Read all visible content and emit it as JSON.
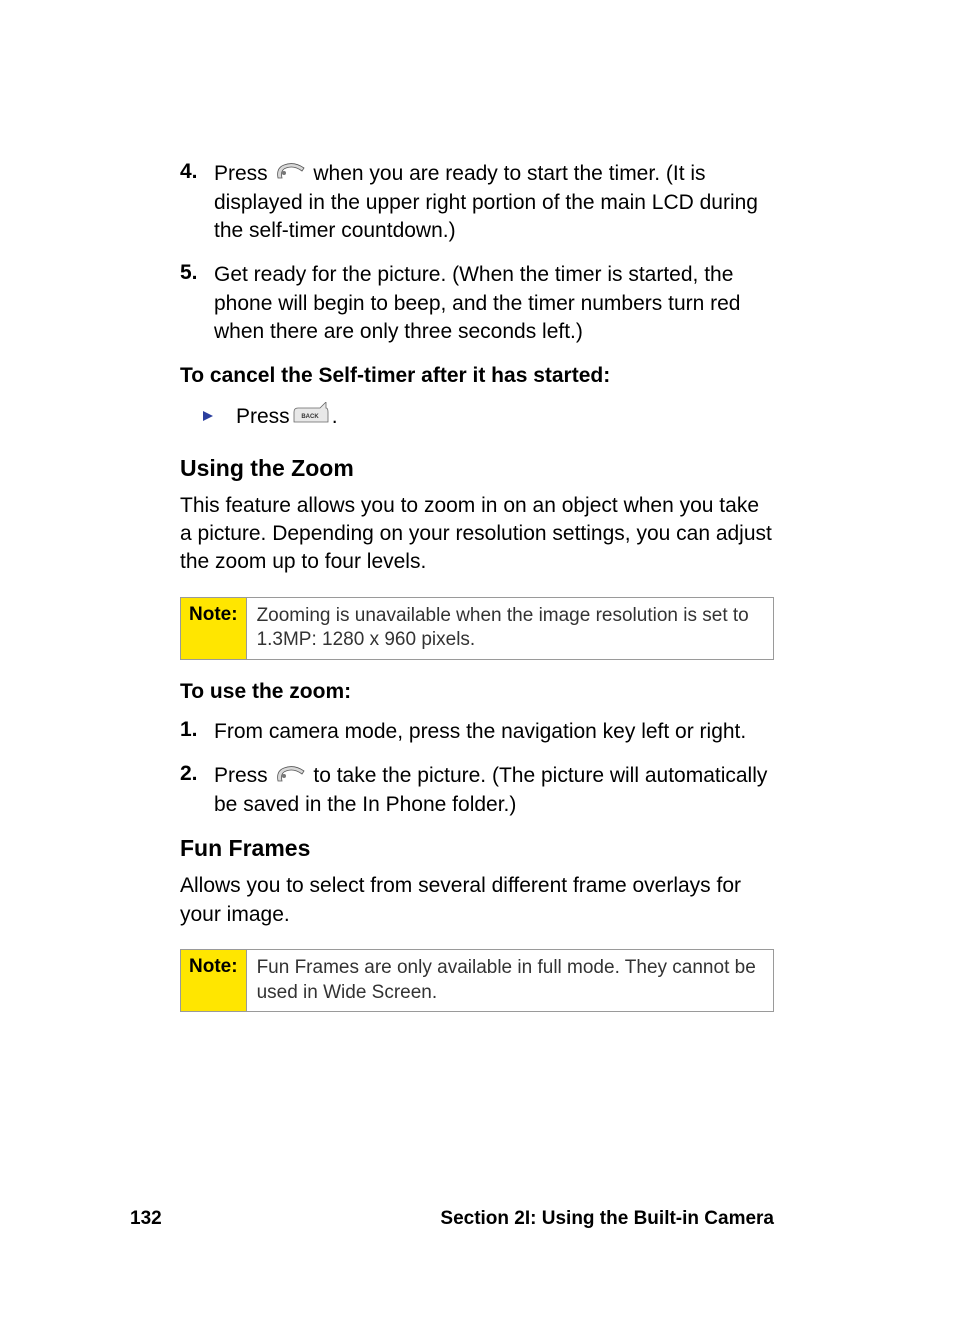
{
  "steps_top": [
    {
      "num": "4.",
      "pre": "Press ",
      "post": " when you are ready to start the timer. (It is displayed in the upper right portion of the main LCD during the self-timer countdown.)"
    },
    {
      "num": "5.",
      "pre": "Get ready for the picture. (When the timer is started, the phone will begin to beep, and the timer numbers turn red when there are only three seconds left.)",
      "post": ""
    }
  ],
  "cancel_title": "To cancel the Self-timer after it has started:",
  "cancel_pre": "Press ",
  "cancel_post": ".",
  "zoom_heading": "Using the Zoom",
  "zoom_para": "This feature allows you to zoom in on an object when you take a picture. Depending on your resolution settings, you can adjust the zoom up to four levels.",
  "note1_label": "Note:",
  "note1_body": "Zooming is unavailable when the image resolution is set to 1.3MP: 1280 x 960 pixels.",
  "use_zoom_title": "To use the zoom:",
  "zoom_steps": [
    {
      "num": "1.",
      "pre": "From camera mode, press the navigation key left or right.",
      "post": ""
    },
    {
      "num": "2.",
      "pre": "Press ",
      "post": " to take the picture. (The picture will automatically be saved in the In Phone folder.)"
    }
  ],
  "fun_heading": "Fun Frames",
  "fun_para": "Allows you to select from several different frame overlays for your image.",
  "note2_label": "Note:",
  "note2_body": "Fun Frames are only available in full mode. They cannot be used in Wide Screen.",
  "footer_page": "132",
  "footer_section": "Section 2I: Using the Built-in Camera"
}
